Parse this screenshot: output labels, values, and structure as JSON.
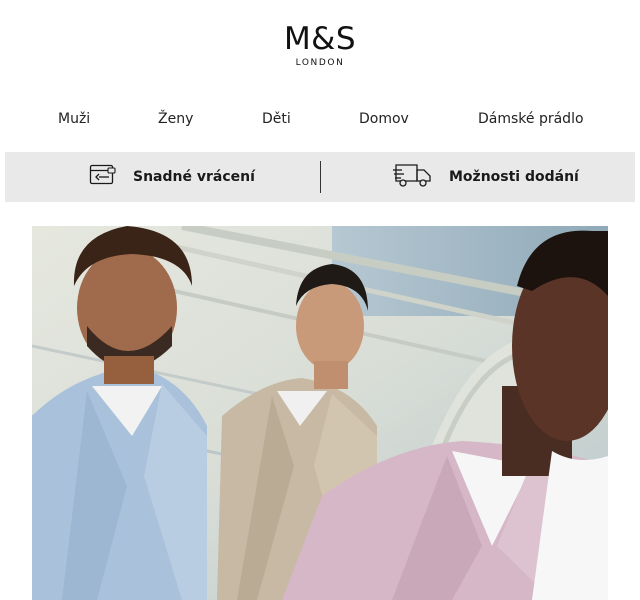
{
  "logo": {
    "mark": "M&S",
    "sub": "LONDON"
  },
  "nav": {
    "items": [
      {
        "label": "Muži"
      },
      {
        "label": "Ženy"
      },
      {
        "label": "Děti"
      },
      {
        "label": "Domov"
      },
      {
        "label": "Dámské prádlo"
      }
    ]
  },
  "services": {
    "returns": {
      "label": "Snadné vrácení",
      "icon": "card-return-icon"
    },
    "delivery": {
      "label": "Možnosti dodání",
      "icon": "delivery-truck-icon"
    }
  },
  "hero": {
    "image": "hero-image",
    "description_icon": "three-men-in-suits-photo"
  },
  "colors": {
    "background": "#ffffff",
    "service_bar": "#e9e9e9",
    "text": "#111111"
  }
}
